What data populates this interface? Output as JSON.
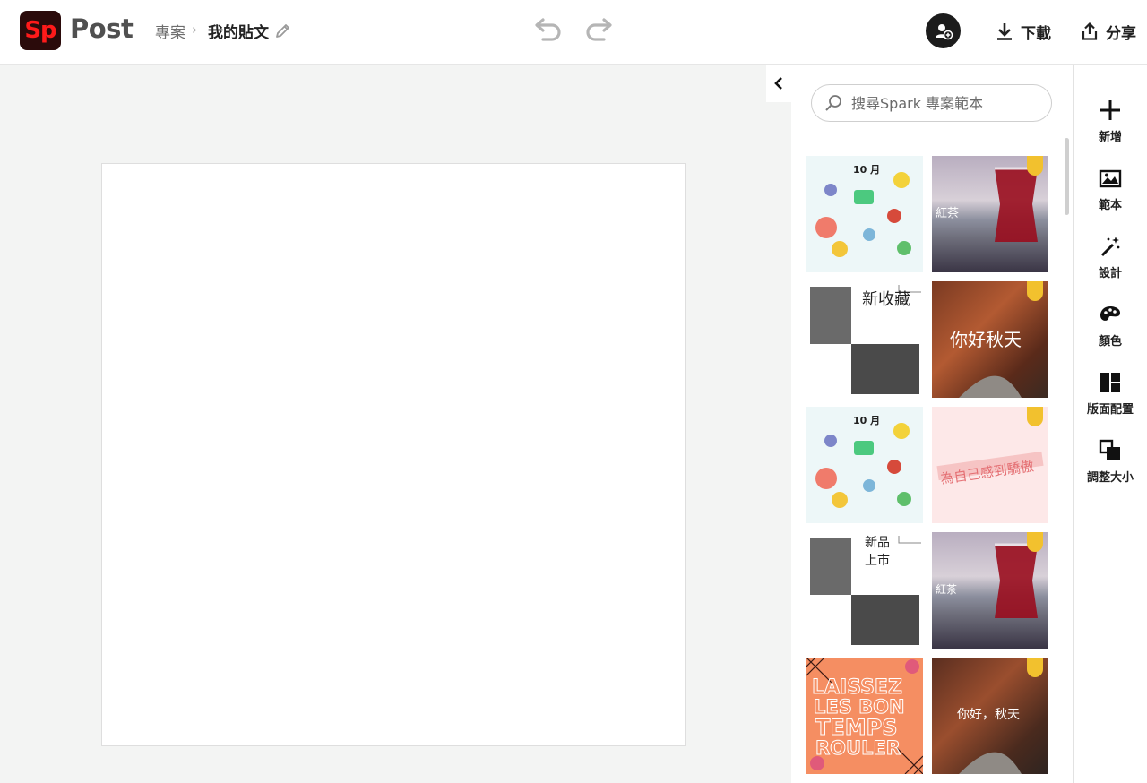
{
  "header": {
    "logo_text": "Sp",
    "product_name": "Post",
    "breadcrumb_parent": "專案",
    "breadcrumb_separator": "›",
    "project_title": "我的貼文",
    "download_label": "下載",
    "share_label": "分享"
  },
  "panel": {
    "search_placeholder": "搜尋Spark 專案範本",
    "templates": [
      {
        "name": "goals-october-a",
        "title": "10 月",
        "premium": false
      },
      {
        "name": "red-tea-a",
        "title": "紅茶",
        "premium": true
      },
      {
        "name": "new-collection",
        "title": "新收藏",
        "premium": false
      },
      {
        "name": "hello-autumn-a",
        "title": "你好秋天",
        "premium": true
      },
      {
        "name": "goals-october-b",
        "title": "10 月",
        "premium": false
      },
      {
        "name": "be-proud",
        "title": "為自己感到驕傲",
        "premium": true
      },
      {
        "name": "new-product",
        "title": "新品\n上市",
        "premium": false
      },
      {
        "name": "red-tea-b",
        "title": "紅茶",
        "premium": true
      },
      {
        "name": "laissez-les-bons-temps",
        "title": "LAISSEZ LES BON TEMPS ROULER",
        "premium": false
      },
      {
        "name": "hello-autumn-b",
        "title": "你好，秋天",
        "premium": true
      }
    ]
  },
  "rail": {
    "items": [
      {
        "label": "新增",
        "icon": "plus-icon"
      },
      {
        "label": "範本",
        "icon": "template-icon"
      },
      {
        "label": "設計",
        "icon": "magic-wand-icon"
      },
      {
        "label": "顏色",
        "icon": "palette-icon"
      },
      {
        "label": "版面配置",
        "icon": "layout-icon"
      },
      {
        "label": "調整大小",
        "icon": "resize-icon"
      }
    ]
  },
  "colors": {
    "logo_bg": "#2b0b0b",
    "logo_text": "#ff1a1a",
    "canvas_bg": "#f3f4f3",
    "premium_badge": "#f2c12e"
  }
}
